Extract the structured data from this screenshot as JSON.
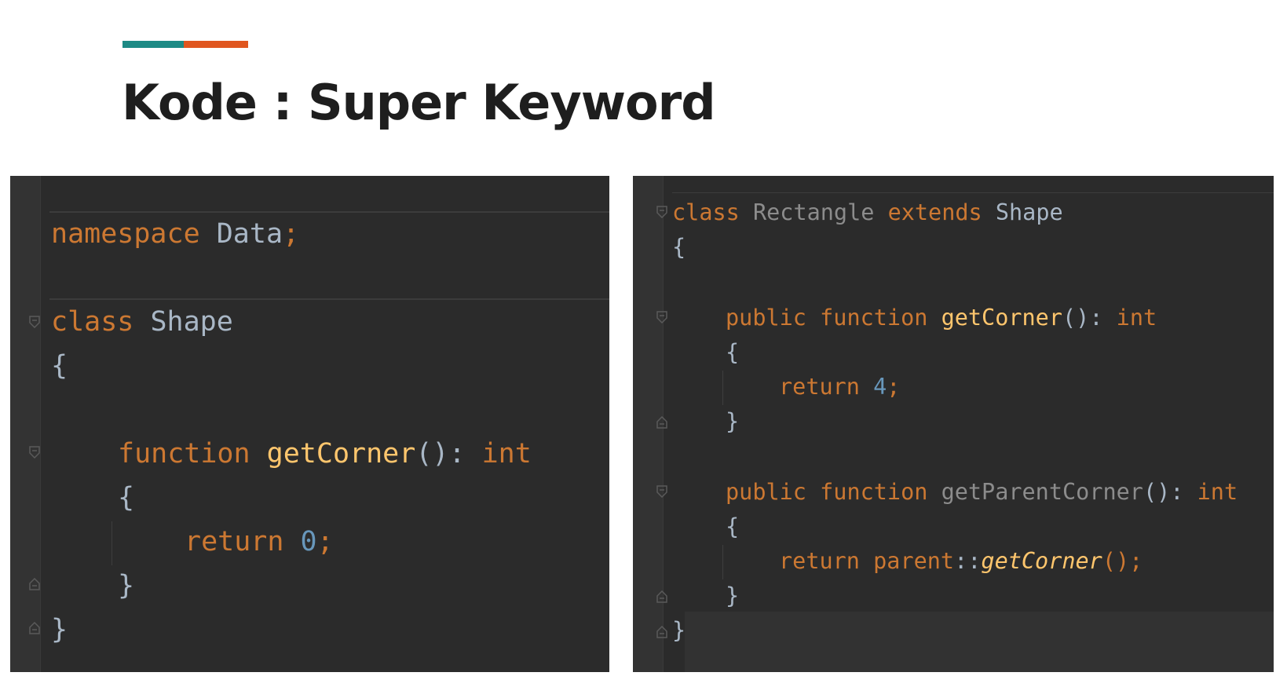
{
  "slide": {
    "title": "Kode : Super Keyword",
    "accent_colors": [
      "#1d8a85",
      "#e0561f"
    ]
  },
  "left_code": {
    "line1": {
      "kw": "namespace",
      "ns": "Data",
      "semi": ";"
    },
    "line2": {
      "kw": "class",
      "name": "Shape"
    },
    "line3": {
      "brace": "{"
    },
    "line4": {
      "kw": "function",
      "fn": "getCorner",
      "parens": "():",
      "type": "int"
    },
    "line5": {
      "brace": "{"
    },
    "line6": {
      "kw": "return",
      "num": "0",
      "semi": ";"
    },
    "line7": {
      "brace": "}"
    },
    "line8": {
      "brace": "}"
    }
  },
  "right_code": {
    "line1": {
      "kw": "class",
      "name": "Rectangle",
      "kw2": "extends",
      "parent": "Shape"
    },
    "line2": {
      "brace": "{"
    },
    "line3": {
      "kw": "public",
      "kw2": "function",
      "fn": "getCorner",
      "parens": "():",
      "type": "int"
    },
    "line4": {
      "brace": "{"
    },
    "line5": {
      "kw": "return",
      "num": "4",
      "semi": ";"
    },
    "line6": {
      "brace": "}"
    },
    "line7": {
      "kw": "public",
      "kw2": "function",
      "fn": "getParentCorner",
      "parens": "():",
      "type": "int"
    },
    "line8": {
      "brace": "{"
    },
    "line9": {
      "kw": "return",
      "scope": "parent",
      "colons": "::",
      "call": "getCorner",
      "tail": "();"
    },
    "line10": {
      "brace": "}"
    },
    "line11": {
      "brace": "}"
    }
  },
  "colors": {
    "keyword": "#cc7832",
    "function": "#ffc66d",
    "number": "#6897bb",
    "identifier": "#a9b7c6",
    "editor_bg": "#2b2b2b"
  },
  "icons": [
    "fold-marker-icon"
  ]
}
